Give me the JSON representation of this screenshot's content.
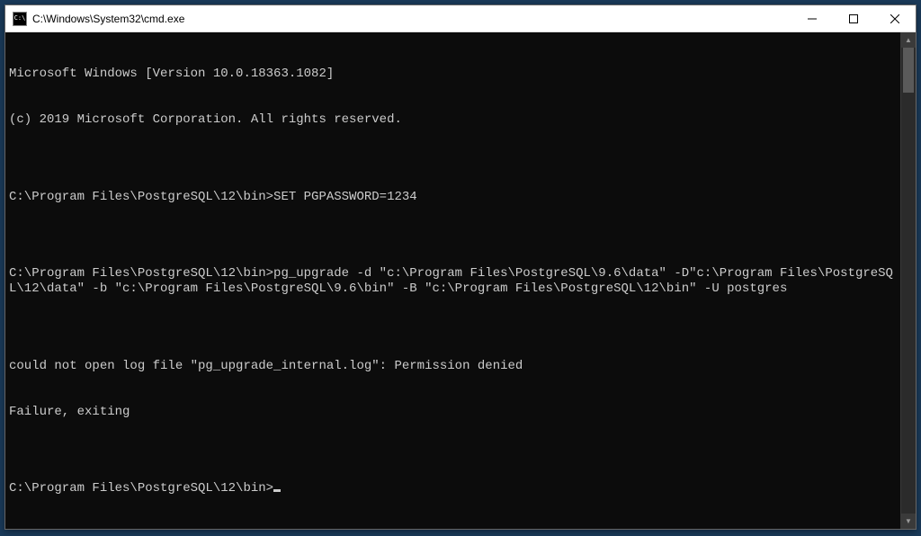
{
  "window": {
    "title": "C:\\Windows\\System32\\cmd.exe",
    "icon_label": "C:\\"
  },
  "terminal": {
    "lines": [
      "Microsoft Windows [Version 10.0.18363.1082]",
      "(c) 2019 Microsoft Corporation. All rights reserved.",
      "",
      "C:\\Program Files\\PostgreSQL\\12\\bin>SET PGPASSWORD=1234",
      "",
      "C:\\Program Files\\PostgreSQL\\12\\bin>pg_upgrade -d \"c:\\Program Files\\PostgreSQL\\9.6\\data\" -D\"c:\\Program Files\\PostgreSQL\\12\\data\" -b \"c:\\Program Files\\PostgreSQL\\9.6\\bin\" -B \"c:\\Program Files\\PostgreSQL\\12\\bin\" -U postgres",
      "",
      "could not open log file \"pg_upgrade_internal.log\": Permission denied",
      "Failure, exiting",
      "",
      "C:\\Program Files\\PostgreSQL\\12\\bin>"
    ]
  },
  "controls": {
    "minimize_label": "Minimize",
    "maximize_label": "Maximize",
    "close_label": "Close"
  }
}
